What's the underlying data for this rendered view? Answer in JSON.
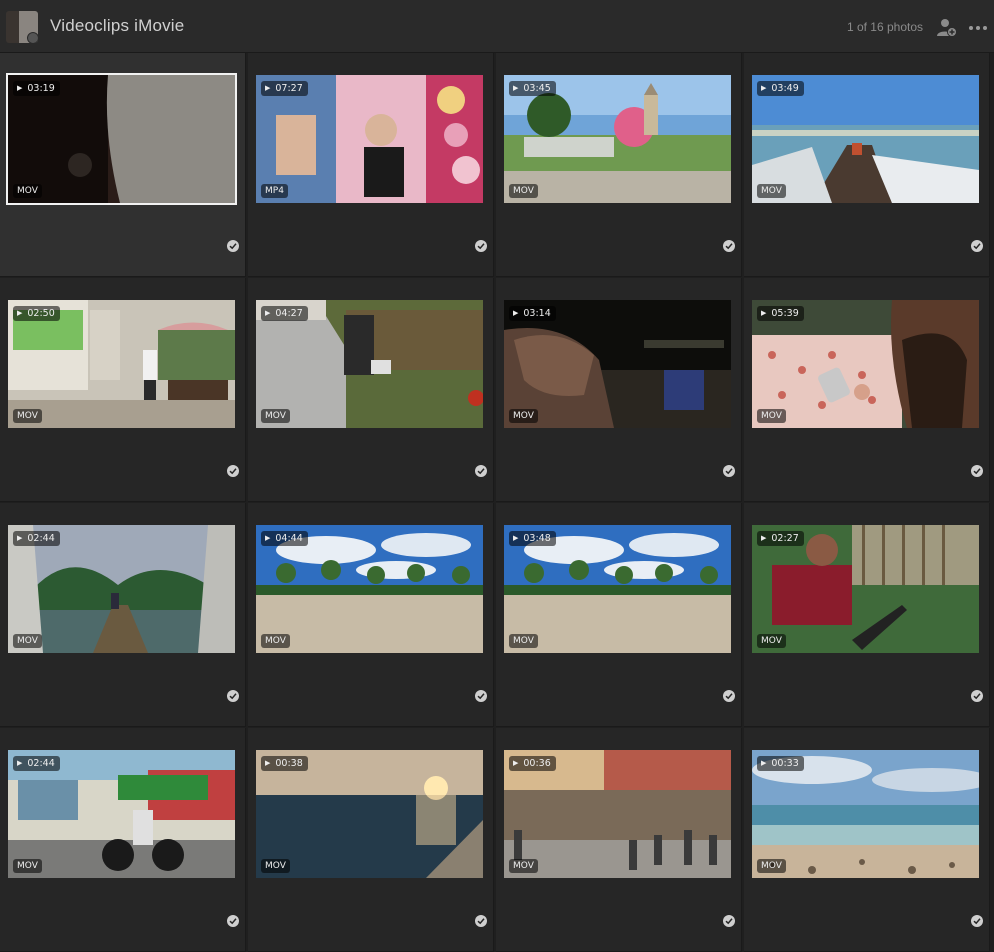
{
  "header": {
    "title": "Videoclips iMovie",
    "count": "1 of 16 photos",
    "add_person_icon": "person-add-icon",
    "more_icon": "ellipsis-icon"
  },
  "clips": [
    {
      "duration": "03:19",
      "format": "MOV",
      "selected": true
    },
    {
      "duration": "07:27",
      "format": "MP4",
      "selected": false
    },
    {
      "duration": "03:45",
      "format": "MOV",
      "selected": false
    },
    {
      "duration": "03:49",
      "format": "MOV",
      "selected": false
    },
    {
      "duration": "02:50",
      "format": "MOV",
      "selected": false
    },
    {
      "duration": "04:27",
      "format": "MOV",
      "selected": false
    },
    {
      "duration": "03:14",
      "format": "MOV",
      "selected": false
    },
    {
      "duration": "05:39",
      "format": "MOV",
      "selected": false
    },
    {
      "duration": "02:44",
      "format": "MOV",
      "selected": false
    },
    {
      "duration": "04:44",
      "format": "MOV",
      "selected": false
    },
    {
      "duration": "03:48",
      "format": "MOV",
      "selected": false
    },
    {
      "duration": "02:27",
      "format": "MOV",
      "selected": false
    },
    {
      "duration": "02:44",
      "format": "MOV",
      "selected": false
    },
    {
      "duration": "00:38",
      "format": "MOV",
      "selected": false
    },
    {
      "duration": "00:36",
      "format": "MOV",
      "selected": false
    },
    {
      "duration": "00:33",
      "format": "MOV",
      "selected": false
    }
  ]
}
